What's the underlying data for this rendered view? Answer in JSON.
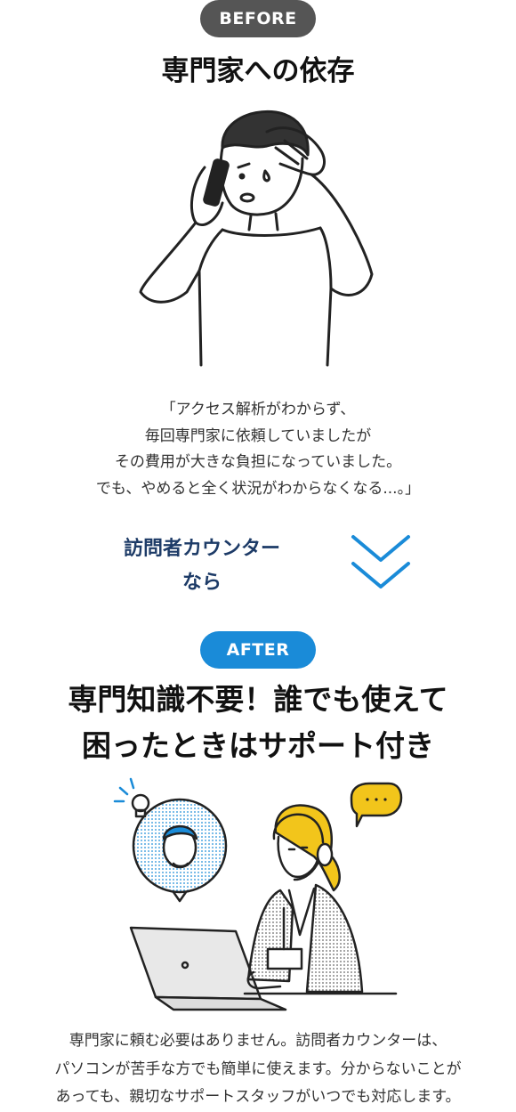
{
  "before": {
    "badge": "BEFORE",
    "title": "専門家への依存",
    "quote_lines": [
      "「アクセス解析がわからず、",
      "毎回専門家に依頼していましたが",
      "その費用が大きな負担になっていました。",
      "でも、やめると全く状況がわからなくなる...。」"
    ]
  },
  "transition": {
    "lines": [
      "訪問者カウンター",
      "なら"
    ],
    "icon": "double-chevron-down-icon"
  },
  "after": {
    "badge": "AFTER",
    "title_lines": [
      "専門知識不要！誰でも使えて",
      "困ったときはサポート付き"
    ],
    "bubble_text": "・・・",
    "description_lines": [
      "専門家に頼む必要はありません。訪問者カウンターは、",
      "パソコンが苦手な方でも簡単に使えます。分からないことが",
      "あっても、親切なサポートスタッフがいつでも対応します。"
    ]
  },
  "colors": {
    "before_badge": "#555555",
    "after_badge": "#1a8bd8",
    "accent_blue": "#1a8bd8",
    "label_navy": "#1d3b67",
    "bubble_yellow": "#f2c51b"
  }
}
